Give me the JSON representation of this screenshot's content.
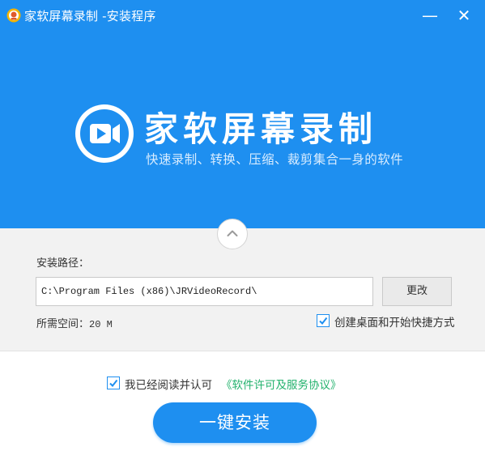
{
  "window": {
    "title": "家软屏幕录制 -安装程序",
    "minimize_symbol": "—",
    "close_symbol": "✕",
    "app_icon": "app-logo-icon"
  },
  "banner": {
    "background_color": "#1e8ff0",
    "logo_icon": "video-camera-icon",
    "product_name": "家软屏幕录制",
    "slogan": "快速录制、转换、压缩、裁剪集合一身的软件"
  },
  "options": {
    "collapse_icon": "chevron-up-icon",
    "path_label": "安装路径：",
    "path_value": "C:\\Program Files (x86)\\JRVideoRecord\\",
    "change_button_label": "更改",
    "space_label": "所需空间：",
    "space_value": "20 M",
    "shortcut_checked": true,
    "shortcut_label": "创建桌面和开始快捷方式"
  },
  "footer": {
    "agree_checked": true,
    "agree_label": "我已经阅读并认可",
    "license_link": "《软件许可及服务协议》",
    "link_color": "#23b26d",
    "install_button_label": "一键安装"
  }
}
